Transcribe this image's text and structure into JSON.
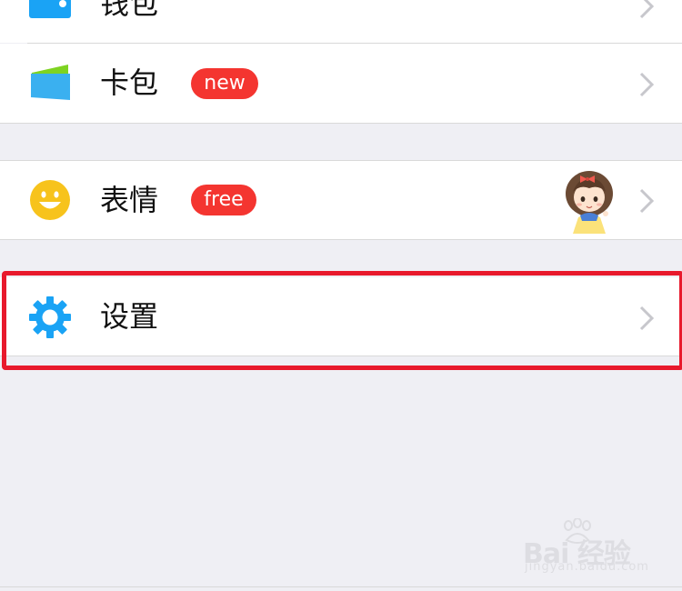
{
  "menu": {
    "wallet": {
      "label": "钱包",
      "icon": "wallet-icon"
    },
    "cards": {
      "label": "卡包",
      "badge": "new",
      "icon": "card-package-icon"
    },
    "stickers": {
      "label": "表情",
      "badge": "free",
      "icon": "smiley-icon",
      "thumbnail": "princess-sticker"
    },
    "settings": {
      "label": "设置",
      "icon": "gear-icon"
    }
  },
  "watermark": {
    "main": "Bai 经验",
    "sub": "jingyan.baidu.com"
  },
  "colors": {
    "accent_blue": "#1aa3f5",
    "badge_red": "#f43530",
    "highlight_red": "#e8192c",
    "background": "#efeff4"
  }
}
